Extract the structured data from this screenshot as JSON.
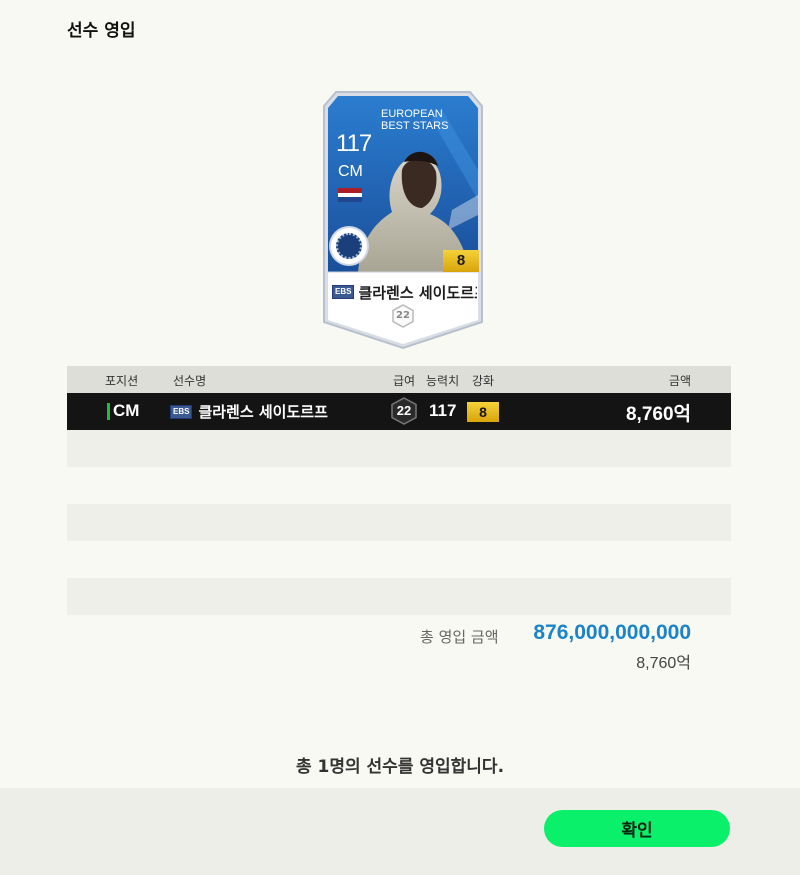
{
  "page": {
    "title": "선수 영입"
  },
  "card": {
    "overall": "117",
    "position": "CM",
    "season_line1": "EUROPEAN",
    "season_line2": "BEST STARS",
    "season_badge": "EBS",
    "name": "클라렌스 세이도르프",
    "upgrade": "8",
    "pay": "22",
    "nation_flag_colors": [
      "#ae1c28",
      "#ffffff",
      "#21468b"
    ],
    "card_color": "#1e63b5"
  },
  "table": {
    "headers": {
      "position": "포지션",
      "name": "선수명",
      "pay": "급여",
      "overall": "능력치",
      "enhance": "강화",
      "price": "금액"
    },
    "rows": [
      {
        "position": "CM",
        "season": "EBS",
        "name": "클라렌스 세이도르프",
        "pay": "22",
        "overall": "117",
        "enhance": "8",
        "price": "8,760억"
      }
    ]
  },
  "total": {
    "label": "총 영입 금액",
    "value": "876,000,000,000",
    "sub": "8,760억"
  },
  "summary": "총 1명의 선수를 영입합니다.",
  "confirm_label": "확인",
  "colors": {
    "accent": "#0af06a",
    "total": "#1b84c9",
    "position_bar": "#1fbb46",
    "enhance": "#f5d13a"
  }
}
